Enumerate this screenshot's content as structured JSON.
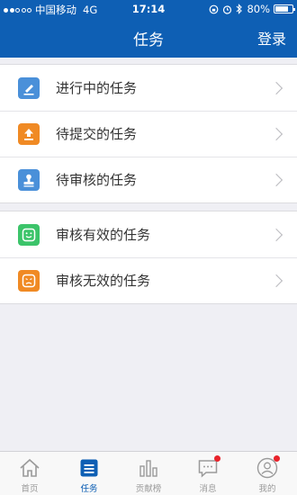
{
  "status_bar": {
    "carrier": "中国移动",
    "network": "4G",
    "time": "17:14",
    "battery": "80%",
    "battery_level": 0.8
  },
  "nav": {
    "title": "任务",
    "login_label": "登录"
  },
  "groups": [
    {
      "items": [
        {
          "label": "进行中的任务",
          "icon": "pencil-icon",
          "color": "#4a90d9"
        },
        {
          "label": "待提交的任务",
          "icon": "upload-icon",
          "color": "#f08a24"
        },
        {
          "label": "待审核的任务",
          "icon": "stamp-icon",
          "color": "#4a90d9"
        }
      ]
    },
    {
      "items": [
        {
          "label": "审核有效的任务",
          "icon": "smile-icon",
          "color": "#3cc46a"
        },
        {
          "label": "审核无效的任务",
          "icon": "frown-icon",
          "color": "#f08a24"
        }
      ]
    }
  ],
  "tabs": [
    {
      "label": "首页",
      "icon": "home-icon",
      "active": false,
      "badge": false
    },
    {
      "label": "任务",
      "icon": "task-list-icon",
      "active": true,
      "badge": false
    },
    {
      "label": "贡献榜",
      "icon": "bar-chart-icon",
      "active": false,
      "badge": false
    },
    {
      "label": "消息",
      "icon": "message-icon",
      "active": false,
      "badge": true
    },
    {
      "label": "我的",
      "icon": "user-icon",
      "active": false,
      "badge": true
    }
  ],
  "colors": {
    "brand": "#0e5fb4",
    "tab_inactive": "#9a9a9a",
    "badge": "#e8232b"
  }
}
